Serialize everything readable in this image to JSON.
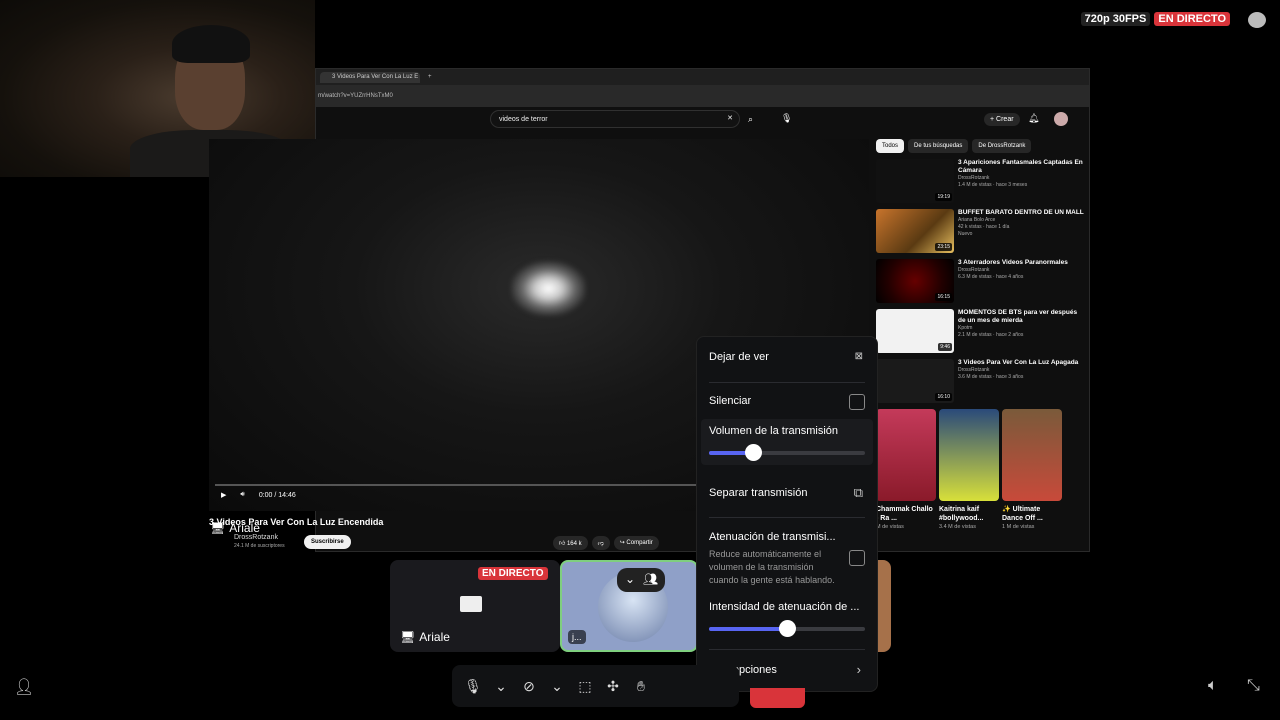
{
  "status": {
    "quality": "720p 30FPS",
    "live": "EN DIRECTO"
  },
  "browser": {
    "tab_title": "3 Videos Para Ver Con La Luz E",
    "url": "m/watch?v=YUZrrHNsTxM0"
  },
  "youtube": {
    "search_value": "videos de terror",
    "create_label": "Crear",
    "time": "0:00 / 14:46",
    "video_title": "3 Videos Para Ver Con La Luz Encendida",
    "channel": "DrossRotzank",
    "subscribers": "24.1 M de suscriptores",
    "subscribe": "Suscribirse",
    "likes": "164 k",
    "share": "Compartir",
    "chips": [
      "Todos",
      "De tus búsquedas",
      "De DrossRotzank"
    ],
    "recs": [
      {
        "title": "3 Apariciones Fantasmales Captadas En Cámara",
        "channel": "DrossRotzank",
        "meta": "1.4 M de vistas · hace 3 meses",
        "dur": "19:19"
      },
      {
        "title": "BUFFET BARATO DENTRO DE UN MALL",
        "channel": "Ariana Bolo Arce",
        "meta": "42 k vistas · hace 1 día",
        "badge": "Nuevo",
        "dur": "23:15"
      },
      {
        "title": "3 Aterradores Videos Paranormales",
        "channel": "DrossRotzank",
        "meta": "6.3 M de vistas · hace 4 años",
        "dur": "16:15"
      },
      {
        "title": "MOMENTOS DE BTS para ver después de un mes de mierda",
        "channel": "Kpotm",
        "meta": "2.1 M de vistas · hace 2 años",
        "dur": "9:46"
      },
      {
        "title": "3 Videos Para Ver Con La Luz Apagada",
        "channel": "DrossRotzank",
        "meta": "3.6 M de vistas · hace 3 años",
        "dur": "16:10"
      }
    ],
    "shorts": [
      {
        "title": "Chammak Challo - Ra ...",
        "meta": "M de vistas"
      },
      {
        "title": "Kaitrina kaif #bollywood...",
        "meta": "3.4 M de vistas"
      },
      {
        "title": "✨ Ultimate Dance Off ...",
        "meta": "1 M de vistas"
      }
    ]
  },
  "stage": {
    "live": "EN DIRECTO",
    "user1": "Ariale",
    "user2": "j...",
    "caption_user": "Ariale"
  },
  "menu": {
    "stop": "Dejar de ver",
    "mute": "Silenciar",
    "volume": "Volumen de la transmisión",
    "volume_level": 0.28,
    "popout": "Separar transmisión",
    "atten": "Atenuación de transmisi...",
    "atten_desc": "Reduce automáticamente el volumen de la transmisión cuando la gente está hablando.",
    "atten_intensity": "Intensidad de atenuación de ...",
    "atten_level": 0.5,
    "more": "Más opciones"
  },
  "colors": {
    "accent": "#5865f2",
    "live": "#d9343a"
  }
}
